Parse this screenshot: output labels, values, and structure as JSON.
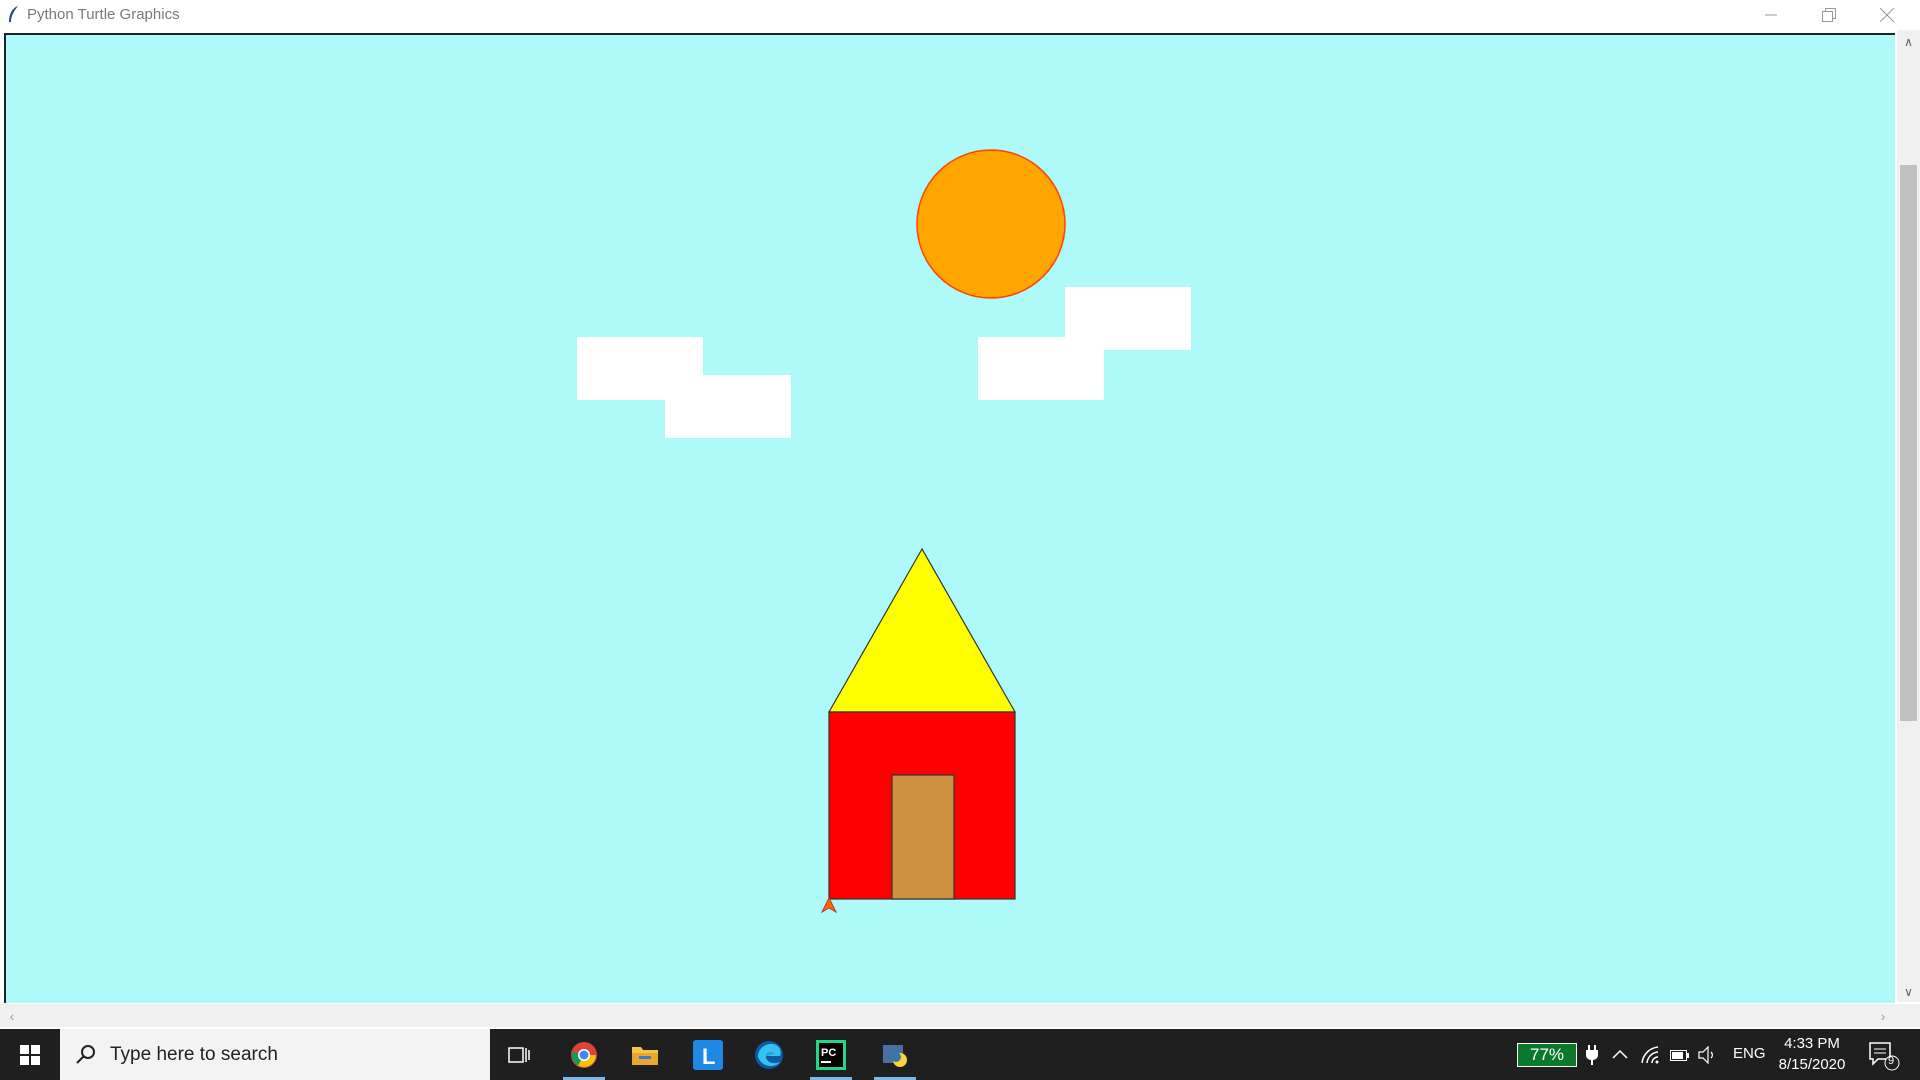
{
  "window": {
    "title": "Python Turtle Graphics",
    "minimize_label": "Minimize",
    "restore_label": "Restore",
    "close_label": "Close"
  },
  "scene": {
    "background": "#aef9f9",
    "sun_color": "#ffa500",
    "sun_outline": "#ff4500",
    "cloud_color": "#ffffff",
    "roof_color": "#ffff00",
    "house_color": "#ff0000",
    "door_color": "#cd9140",
    "turtle_color": "#ff6a00"
  },
  "taskbar": {
    "search_placeholder": "Type here to search",
    "apps": [
      "task-view",
      "chrome",
      "file-explorer",
      "l-app",
      "edge",
      "pycharm",
      "python"
    ],
    "battery": "77%",
    "language": "ENG",
    "time": "4:33 PM",
    "date": "8/15/2020",
    "notifications": "9"
  }
}
